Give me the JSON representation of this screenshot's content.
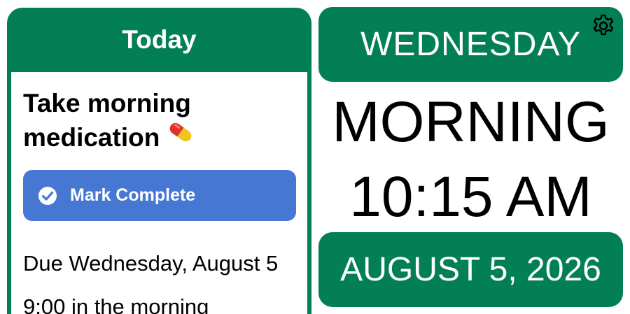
{
  "colors": {
    "accent_green": "#037f56",
    "button_blue": "#4677d3",
    "pill_red": "#e0322b",
    "pill_yellow": "#f2c422"
  },
  "today_panel": {
    "header": "Today",
    "task_title": "Take morning medication",
    "task_icon": "pill-icon",
    "mark_complete_label": "Mark Complete",
    "due_label": "Due Wednesday, August 5",
    "time_label": "9:00 in the morning"
  },
  "clock_panel": {
    "day": "WEDNESDAY",
    "settings_icon": "gear-icon",
    "period": "MORNING",
    "time": "10:15 AM",
    "date": "AUGUST 5, 2026"
  }
}
